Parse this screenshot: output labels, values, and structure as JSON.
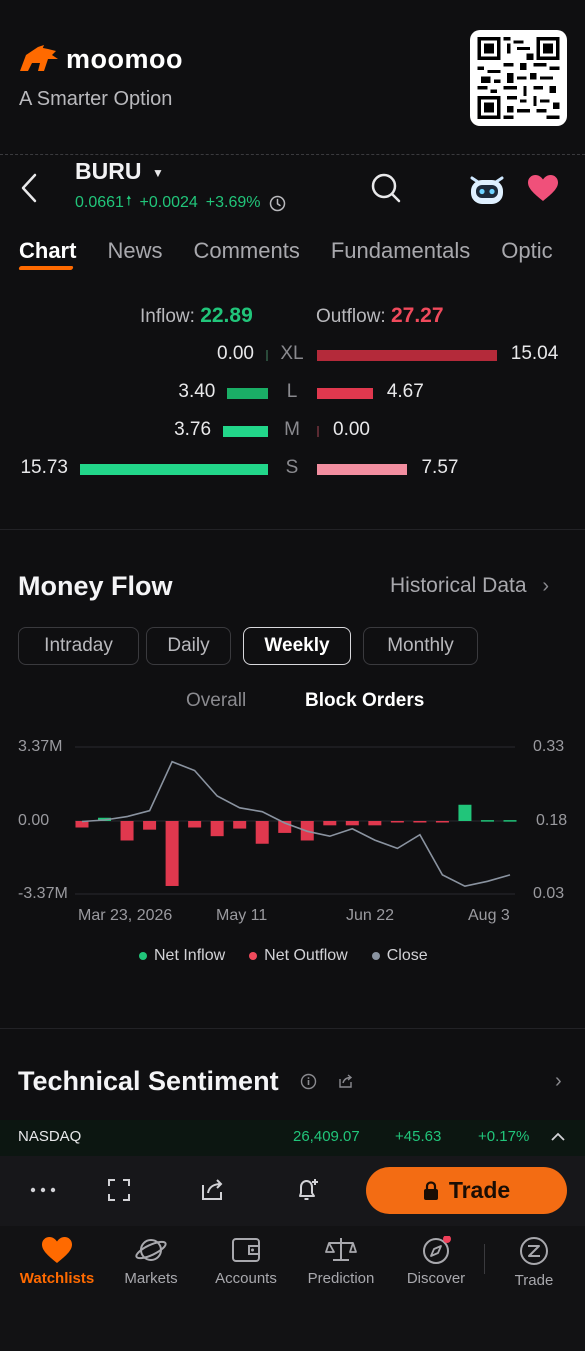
{
  "brand": {
    "name": "moomoo",
    "tagline": "A Smarter Option"
  },
  "stock": {
    "ticker": "BURU",
    "price": "0.0661",
    "change": "+0.0024",
    "change_pct": "+3.69%"
  },
  "tabs": [
    {
      "label": "Chart",
      "active": true
    },
    {
      "label": "News"
    },
    {
      "label": "Comments"
    },
    {
      "label": "Fundamentals"
    },
    {
      "label": "Optic"
    }
  ],
  "flow_summary": {
    "inflow_label": "Inflow:",
    "inflow_value": "22.89",
    "outflow_label": "Outflow:",
    "outflow_value": "27.27",
    "rows": [
      {
        "size": "XL",
        "inflow": 0.0,
        "inflow_text": "0.00",
        "outflow": 15.04,
        "outflow_text": "15.04"
      },
      {
        "size": "L",
        "inflow": 3.4,
        "inflow_text": "3.40",
        "outflow": 4.67,
        "outflow_text": "4.67"
      },
      {
        "size": "M",
        "inflow": 3.76,
        "inflow_text": "3.76",
        "outflow": 0.0,
        "outflow_text": "0.00"
      },
      {
        "size": "S",
        "inflow": 15.73,
        "inflow_text": "15.73",
        "outflow": 7.57,
        "outflow_text": "7.57"
      }
    ]
  },
  "money_flow": {
    "title": "Money Flow",
    "historical_label": "Historical Data",
    "periods": [
      "Intraday",
      "Daily",
      "Weekly",
      "Monthly"
    ],
    "active_period": "Weekly",
    "subtabs": [
      "Overall",
      "Block Orders"
    ],
    "active_subtab": "Block Orders",
    "legend": [
      "Net Inflow",
      "Net Outflow",
      "Close"
    ]
  },
  "chart_data": {
    "type": "bar",
    "title": "",
    "x_ticks": [
      "Mar 23, 2026",
      "May 11",
      "Jun 22",
      "Aug 3"
    ],
    "y_left_ticks": [
      "3.37M",
      "0.00",
      "-3.37M"
    ],
    "y_right_ticks": [
      "0.33",
      "0.18",
      "0.03"
    ],
    "y_left_range": [
      -3.37,
      3.37
    ],
    "y_right_range": [
      0.03,
      0.33
    ],
    "series": [
      {
        "name": "Net Flow (M)",
        "type": "bar",
        "values": [
          -0.3,
          0.15,
          -0.9,
          -0.4,
          -3.0,
          -0.3,
          -0.7,
          -0.35,
          -1.05,
          -0.55,
          -0.9,
          -0.2,
          -0.2,
          -0.2,
          -0.07,
          -0.07,
          -0.07,
          0.75,
          0.04,
          0.04
        ]
      },
      {
        "name": "Close",
        "type": "line",
        "values": [
          0.178,
          0.181,
          0.188,
          0.2,
          0.3,
          0.282,
          0.23,
          0.206,
          0.198,
          0.175,
          0.158,
          0.148,
          0.163,
          0.14,
          0.123,
          0.151,
          0.069,
          0.046,
          0.056,
          0.069
        ]
      }
    ]
  },
  "technical": {
    "title": "Technical Sentiment"
  },
  "index_ticker": {
    "name": "NASDAQ",
    "value": "26,409.07",
    "change": "+45.63",
    "change_pct": "+0.17%"
  },
  "toolbar": {
    "trade_label": "Trade"
  },
  "nav": [
    {
      "label": "Watchlists",
      "icon": "heart-icon",
      "active": true
    },
    {
      "label": "Markets",
      "icon": "planet-icon"
    },
    {
      "label": "Accounts",
      "icon": "wallet-icon"
    },
    {
      "label": "Prediction",
      "icon": "scale-icon"
    },
    {
      "label": "Discover",
      "icon": "compass-icon"
    },
    {
      "label": "Trade",
      "icon": "trade-icon"
    }
  ],
  "colors": {
    "accent": "#ff6a00",
    "positive": "#21c57a",
    "negative": "#f04a5c",
    "background": "#0f0f11"
  }
}
